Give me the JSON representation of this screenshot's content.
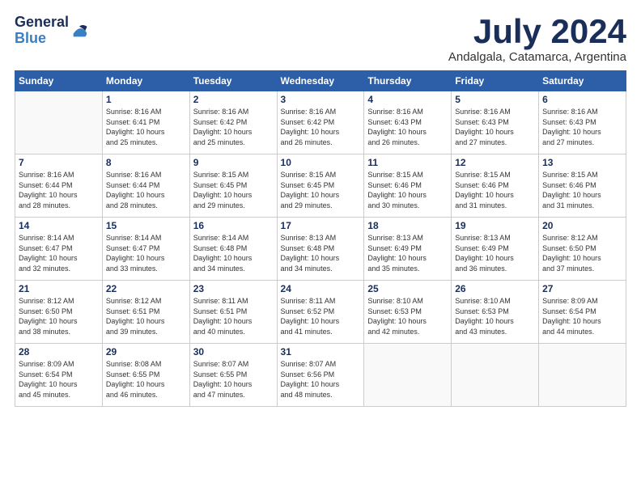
{
  "logo": {
    "general": "General",
    "blue": "Blue"
  },
  "title": "July 2024",
  "subtitle": "Andalgala, Catamarca, Argentina",
  "headers": [
    "Sunday",
    "Monday",
    "Tuesday",
    "Wednesday",
    "Thursday",
    "Friday",
    "Saturday"
  ],
  "weeks": [
    [
      {
        "day": "",
        "info": ""
      },
      {
        "day": "1",
        "info": "Sunrise: 8:16 AM\nSunset: 6:41 PM\nDaylight: 10 hours\nand 25 minutes."
      },
      {
        "day": "2",
        "info": "Sunrise: 8:16 AM\nSunset: 6:42 PM\nDaylight: 10 hours\nand 25 minutes."
      },
      {
        "day": "3",
        "info": "Sunrise: 8:16 AM\nSunset: 6:42 PM\nDaylight: 10 hours\nand 26 minutes."
      },
      {
        "day": "4",
        "info": "Sunrise: 8:16 AM\nSunset: 6:43 PM\nDaylight: 10 hours\nand 26 minutes."
      },
      {
        "day": "5",
        "info": "Sunrise: 8:16 AM\nSunset: 6:43 PM\nDaylight: 10 hours\nand 27 minutes."
      },
      {
        "day": "6",
        "info": "Sunrise: 8:16 AM\nSunset: 6:43 PM\nDaylight: 10 hours\nand 27 minutes."
      }
    ],
    [
      {
        "day": "7",
        "info": "Sunrise: 8:16 AM\nSunset: 6:44 PM\nDaylight: 10 hours\nand 28 minutes."
      },
      {
        "day": "8",
        "info": "Sunrise: 8:16 AM\nSunset: 6:44 PM\nDaylight: 10 hours\nand 28 minutes."
      },
      {
        "day": "9",
        "info": "Sunrise: 8:15 AM\nSunset: 6:45 PM\nDaylight: 10 hours\nand 29 minutes."
      },
      {
        "day": "10",
        "info": "Sunrise: 8:15 AM\nSunset: 6:45 PM\nDaylight: 10 hours\nand 29 minutes."
      },
      {
        "day": "11",
        "info": "Sunrise: 8:15 AM\nSunset: 6:46 PM\nDaylight: 10 hours\nand 30 minutes."
      },
      {
        "day": "12",
        "info": "Sunrise: 8:15 AM\nSunset: 6:46 PM\nDaylight: 10 hours\nand 31 minutes."
      },
      {
        "day": "13",
        "info": "Sunrise: 8:15 AM\nSunset: 6:46 PM\nDaylight: 10 hours\nand 31 minutes."
      }
    ],
    [
      {
        "day": "14",
        "info": "Sunrise: 8:14 AM\nSunset: 6:47 PM\nDaylight: 10 hours\nand 32 minutes."
      },
      {
        "day": "15",
        "info": "Sunrise: 8:14 AM\nSunset: 6:47 PM\nDaylight: 10 hours\nand 33 minutes."
      },
      {
        "day": "16",
        "info": "Sunrise: 8:14 AM\nSunset: 6:48 PM\nDaylight: 10 hours\nand 34 minutes."
      },
      {
        "day": "17",
        "info": "Sunrise: 8:13 AM\nSunset: 6:48 PM\nDaylight: 10 hours\nand 34 minutes."
      },
      {
        "day": "18",
        "info": "Sunrise: 8:13 AM\nSunset: 6:49 PM\nDaylight: 10 hours\nand 35 minutes."
      },
      {
        "day": "19",
        "info": "Sunrise: 8:13 AM\nSunset: 6:49 PM\nDaylight: 10 hours\nand 36 minutes."
      },
      {
        "day": "20",
        "info": "Sunrise: 8:12 AM\nSunset: 6:50 PM\nDaylight: 10 hours\nand 37 minutes."
      }
    ],
    [
      {
        "day": "21",
        "info": "Sunrise: 8:12 AM\nSunset: 6:50 PM\nDaylight: 10 hours\nand 38 minutes."
      },
      {
        "day": "22",
        "info": "Sunrise: 8:12 AM\nSunset: 6:51 PM\nDaylight: 10 hours\nand 39 minutes."
      },
      {
        "day": "23",
        "info": "Sunrise: 8:11 AM\nSunset: 6:51 PM\nDaylight: 10 hours\nand 40 minutes."
      },
      {
        "day": "24",
        "info": "Sunrise: 8:11 AM\nSunset: 6:52 PM\nDaylight: 10 hours\nand 41 minutes."
      },
      {
        "day": "25",
        "info": "Sunrise: 8:10 AM\nSunset: 6:53 PM\nDaylight: 10 hours\nand 42 minutes."
      },
      {
        "day": "26",
        "info": "Sunrise: 8:10 AM\nSunset: 6:53 PM\nDaylight: 10 hours\nand 43 minutes."
      },
      {
        "day": "27",
        "info": "Sunrise: 8:09 AM\nSunset: 6:54 PM\nDaylight: 10 hours\nand 44 minutes."
      }
    ],
    [
      {
        "day": "28",
        "info": "Sunrise: 8:09 AM\nSunset: 6:54 PM\nDaylight: 10 hours\nand 45 minutes."
      },
      {
        "day": "29",
        "info": "Sunrise: 8:08 AM\nSunset: 6:55 PM\nDaylight: 10 hours\nand 46 minutes."
      },
      {
        "day": "30",
        "info": "Sunrise: 8:07 AM\nSunset: 6:55 PM\nDaylight: 10 hours\nand 47 minutes."
      },
      {
        "day": "31",
        "info": "Sunrise: 8:07 AM\nSunset: 6:56 PM\nDaylight: 10 hours\nand 48 minutes."
      },
      {
        "day": "",
        "info": ""
      },
      {
        "day": "",
        "info": ""
      },
      {
        "day": "",
        "info": ""
      }
    ]
  ]
}
